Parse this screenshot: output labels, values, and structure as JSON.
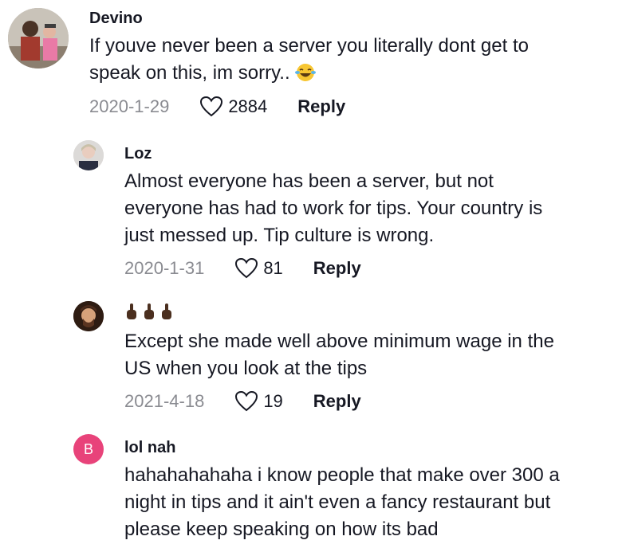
{
  "comments": [
    {
      "username": "Devino",
      "lines": [
        "If youve never been a server you literally dont get to",
        "speak on this, im sorry.."
      ],
      "emoji": "laughing-tears-emoji",
      "date": "2020-1-29",
      "likes": "2884",
      "reply_label": "Reply"
    },
    {
      "username": "Loz",
      "lines": [
        "Almost everyone has been a server, but not",
        "everyone has had to work for tips. Your country is",
        "just messed up. Tip culture is wrong."
      ],
      "date": "2020-1-31",
      "likes": "81",
      "reply_label": "Reply"
    },
    {
      "username": "",
      "username_emoji": "middle-finger-emoji ×3",
      "lines": [
        "Except she made well above minimum wage in the",
        "US when you look at the tips"
      ],
      "date": "2021-4-18",
      "likes": "19",
      "reply_label": "Reply"
    },
    {
      "username": "lol nah",
      "avatar_letter": "B",
      "lines": [
        "hahahahahaha i know people that make over 300 a",
        "night in tips and it ain't even a fancy restaurant but",
        "please keep speaking on how its bad"
      ]
    }
  ],
  "colors": {
    "text": "#161823",
    "muted": "#8a8b91",
    "letter_avatar": "#e8437a"
  }
}
